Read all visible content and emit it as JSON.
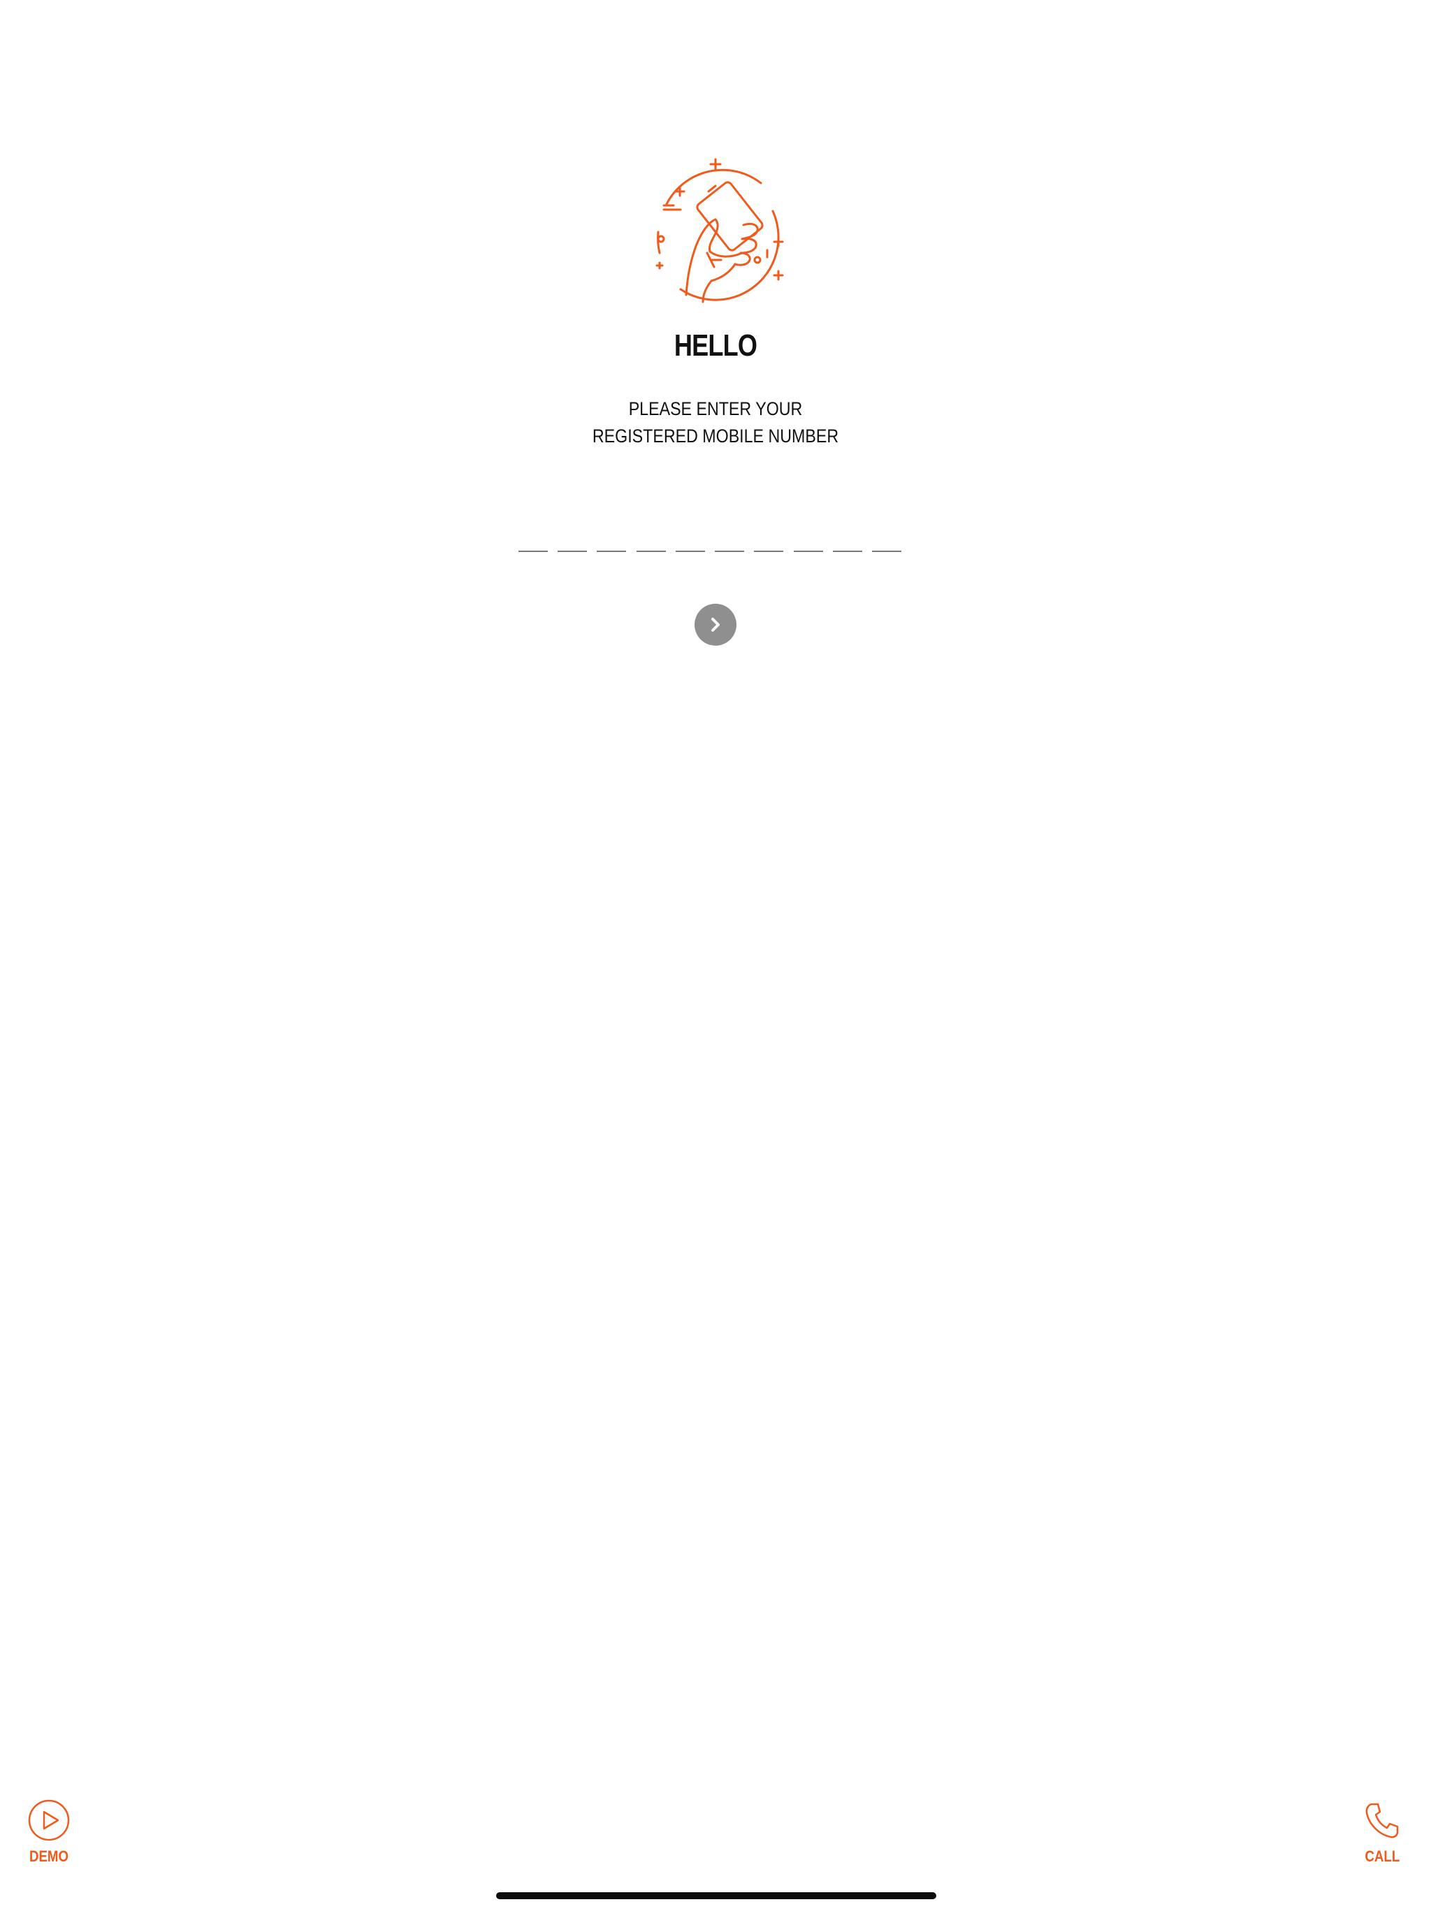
{
  "colors": {
    "accent": "#f05a1a",
    "next_button": "#8f8f8f",
    "text": "#111111",
    "background": "#ffffff"
  },
  "header": {
    "illustration_icon": "hand-holding-phone-icon"
  },
  "login": {
    "title": "HELLO",
    "subtitle_line1": "PLEASE ENTER YOUR",
    "subtitle_line2": "REGISTERED MOBILE NUMBER",
    "phone_digits": [
      "",
      "",
      "",
      "",
      "",
      "",
      "",
      "",
      "",
      ""
    ],
    "next_icon": "chevron-right-icon"
  },
  "footer": {
    "demo": {
      "label": "DEMO",
      "icon": "play-circle-icon"
    },
    "call": {
      "label": "CALL",
      "icon": "phone-icon"
    }
  }
}
